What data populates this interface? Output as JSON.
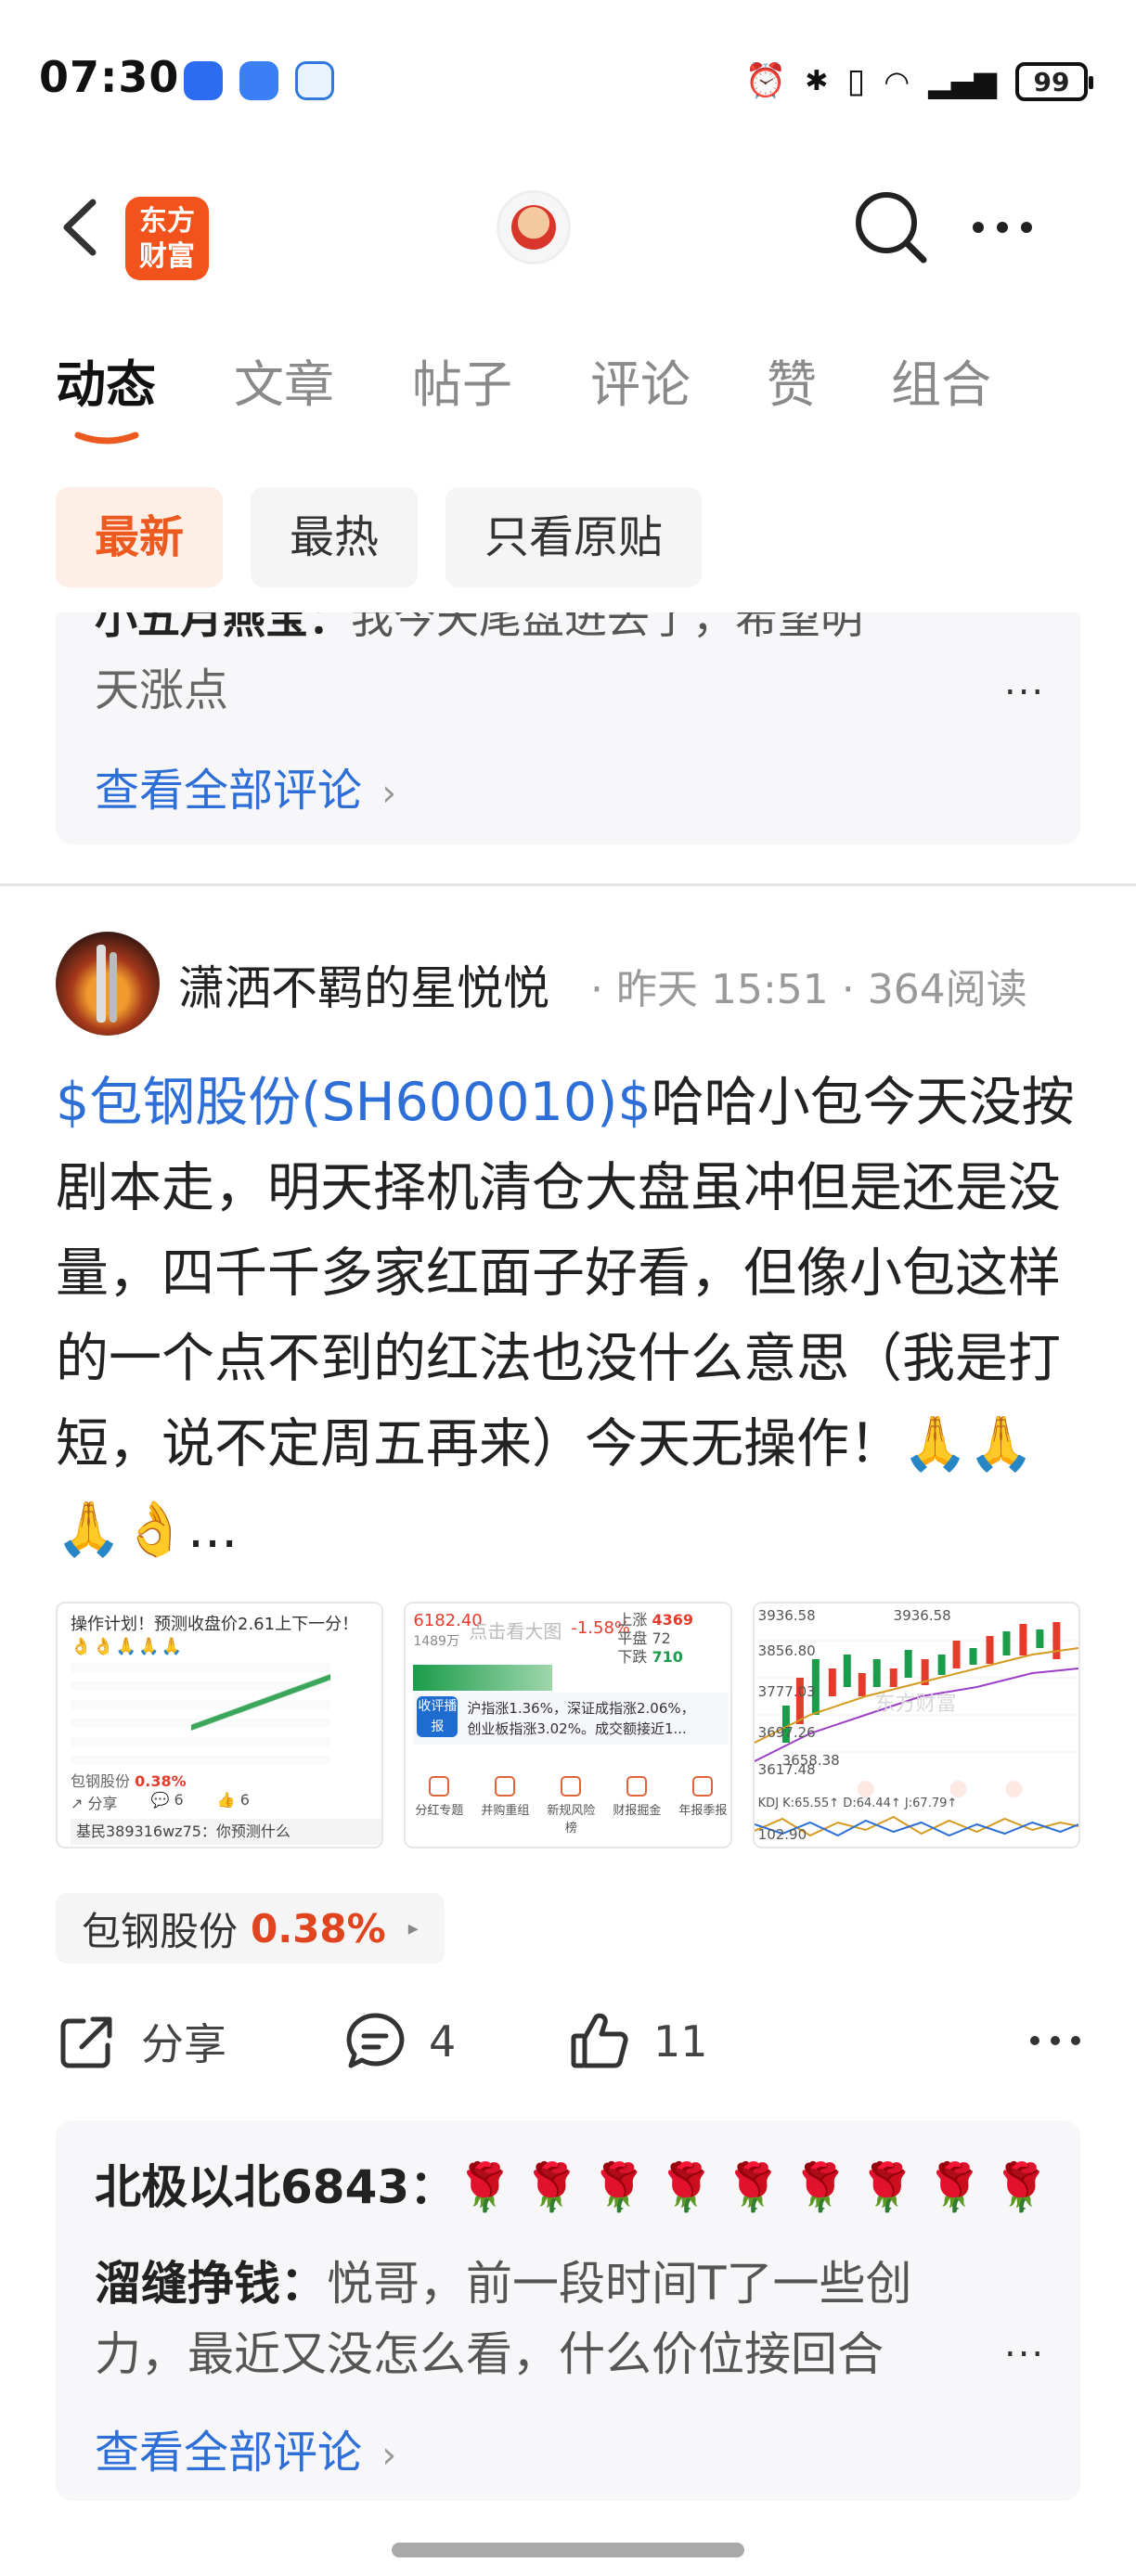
{
  "status_bar": {
    "time": "07:30",
    "battery": "99",
    "icons": [
      "alarm-icon",
      "bluetooth-icon",
      "vibrate-icon",
      "wifi-icon",
      "signal-icon"
    ]
  },
  "nav": {
    "logo_line1": "东方",
    "logo_line2": "财富"
  },
  "tabs": [
    {
      "label": "动态",
      "active": true
    },
    {
      "label": "文章"
    },
    {
      "label": "帖子"
    },
    {
      "label": "评论"
    },
    {
      "label": "赞"
    },
    {
      "label": "组合"
    }
  ],
  "filters": [
    {
      "label": "最新",
      "active": true
    },
    {
      "label": "最热"
    },
    {
      "label": "只看原贴"
    }
  ],
  "prev_comments": {
    "cut_author": "小五月燕宝：",
    "cut_text": "我今天尾盘进去了，希望明",
    "line2": "天涨点",
    "more": "...",
    "view_all": "查看全部评论",
    "view_all_arrow": "›"
  },
  "post": {
    "author": "潇洒不羁的星悦悦",
    "meta": "· 昨天 15:51 · 364阅读",
    "stock_link": "$包钢股份(SH600010)$",
    "body": "哈哈小包今天没按剧本走，明天择机清仓大盘虽冲但是还是没量，四千千多家红面子好看，但像小包这样的一个点不到的红法也没什么意思（我是打短，说不定周五再来）今天无操作！🙏🙏🙏👌...",
    "thumbs": {
      "t1": {
        "title": "操作计划！预测收盘价2.61上下一分！",
        "emoji": "👌👌🙏🙏🙏",
        "stock": "包钢股份",
        "stock_pct": "0.38%",
        "share": "分享",
        "comments": "6",
        "likes": "6",
        "reply": "基民389316wz75：你预测什么"
      },
      "t2": {
        "index": "6182.40",
        "sub": "1489万",
        "click": "点击看大图",
        "pct": "-1.58%",
        "up_label": "上涨",
        "up": "4369",
        "flat_label": "平盘",
        "flat": "72",
        "down_label": "下跌",
        "down": "710",
        "badge": "收评播报",
        "news1": "沪指涨1.36%，深证成指涨2.06%，",
        "news2": "创业板指涨3.02%。成交额接近1...",
        "icons": [
          "分红专题",
          "并购重组",
          "新规风险榜",
          "财报掘金",
          "年报季报"
        ]
      },
      "t3": {
        "p1": "3936.58",
        "p2": "3856.80",
        "p3": "3777.03",
        "p4": "3697.26",
        "p5": "3617.48",
        "low": "3658.38",
        "kdj": "KDJ  K:65.55↑ D:64.44↑ J:67.79↑",
        "bottom": "102.90",
        "watermark": "东方财富",
        "top_right": "3936.58"
      }
    },
    "stock_tag": {
      "name": "包钢股份",
      "pct": "0.38%",
      "arrow": "▸"
    },
    "actions": {
      "share": "分享",
      "comments": "4",
      "likes": "11"
    }
  },
  "post_comments": {
    "c1_author": "北极以北6843：",
    "c1_text": "🌹🌹🌹🌹🌹🌹🌹🌹🌹",
    "c2_author": "溜缝挣钱：",
    "c2_text": "悦哥，前一段时间T了一些创",
    "c2_line2": "力，最近又没怎么看，什么价位接回合",
    "more": "...",
    "view_all": "查看全部评论",
    "view_all_arrow": "›"
  },
  "colors": {
    "accent": "#ec5a1f",
    "link": "#2d6fd6",
    "up_red": "#e53b2c",
    "down_green": "#1b9c4b"
  }
}
